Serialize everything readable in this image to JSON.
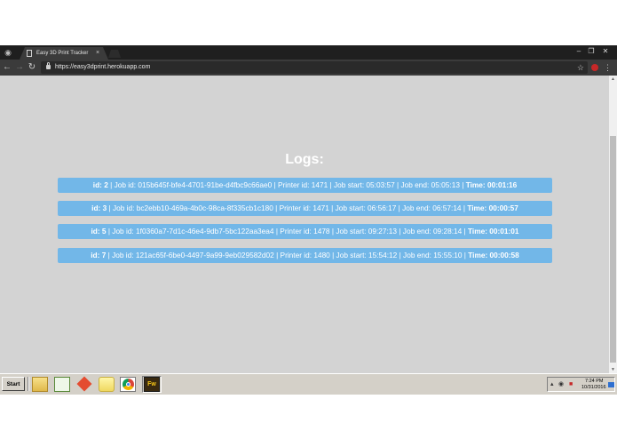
{
  "browser": {
    "tab_title": "Easy 3D Print Tracker",
    "tab_close": "×",
    "url": "https://easy3dprint.herokuapp.com",
    "window_controls": {
      "minimize": "–",
      "maximize": "❐",
      "close": "✕"
    },
    "nav": {
      "back": "←",
      "forward": "→",
      "reload": "↻"
    },
    "star": "☆",
    "menu": "⋮"
  },
  "page": {
    "title": "Logs:",
    "logs": [
      {
        "id_label": "id: 2",
        "details": " | Job id: 015b645f-bfe4-4701-91be-d4fbc9c66ae0 | Printer id: 1471 | Job start: 05:03:57 | Job end: 05:05:13 | ",
        "time_label": "Time: 00:01:16"
      },
      {
        "id_label": "id: 3",
        "details": " | Job id: bc2ebb10-469a-4b0c-98ca-8f335cb1c180 | Printer id: 1471 | Job start: 06:56:17 | Job end: 06:57:14 | ",
        "time_label": "Time: 00:00:57"
      },
      {
        "id_label": "id: 5",
        "details": " | Job id: 1f0360a7-7d1c-46e4-9db7-5bc122aa3ea4 | Printer id: 1478 | Job start: 09:27:13 | Job end: 09:28:14 | ",
        "time_label": "Time: 00:01:01"
      },
      {
        "id_label": "id: 7",
        "details": " | Job id: 121ac65f-6be0-4497-9a99-9eb029582d02 | Printer id: 1480 | Job start: 15:54:12 | Job end: 15:55:10 | ",
        "time_label": "Time: 00:00:58"
      }
    ]
  },
  "taskbar": {
    "start_label": "Start",
    "fireworks_label": "Fw",
    "clock_time": "7:24 PM",
    "clock_date": "10/31/2016"
  },
  "colors": {
    "log_row_bg": "#72b7e8",
    "page_bg": "#d3d3d3",
    "title_color": "#ffffff"
  }
}
